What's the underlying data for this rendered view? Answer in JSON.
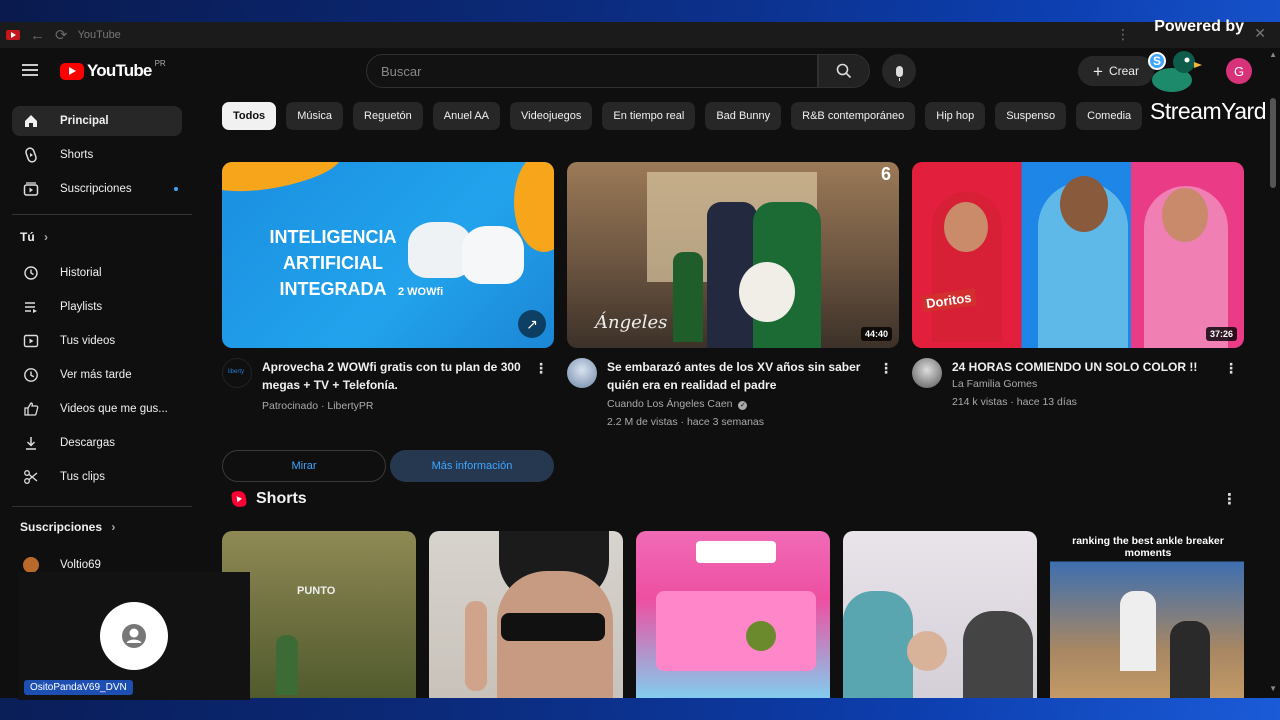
{
  "window": {
    "title": "YouTube"
  },
  "header": {
    "logo_text": "YouTube",
    "region": "PR",
    "search_placeholder": "Buscar",
    "create_label": "Crear",
    "avatar_letter": "G",
    "overlay_avatar_letter": "S"
  },
  "streamyard": {
    "powered_by": "Powered by",
    "name": "StreamYard"
  },
  "sidebar": {
    "top": [
      {
        "label": "Principal",
        "icon": "home-icon"
      },
      {
        "label": "Shorts",
        "icon": "shorts-icon"
      },
      {
        "label": "Suscripciones",
        "icon": "subscriptions-icon"
      }
    ],
    "you_title": "Tú",
    "you_items": [
      {
        "label": "Historial",
        "icon": "history-icon"
      },
      {
        "label": "Playlists",
        "icon": "playlists-icon"
      },
      {
        "label": "Tus videos",
        "icon": "your-videos-icon"
      },
      {
        "label": "Ver más tarde",
        "icon": "watch-later-icon"
      },
      {
        "label": "Videos que me gus...",
        "icon": "liked-icon"
      },
      {
        "label": "Descargas",
        "icon": "download-icon"
      },
      {
        "label": "Tus clips",
        "icon": "clips-icon"
      }
    ],
    "subs_title": "Suscripciones",
    "subs_first": "Voltio69"
  },
  "chips": [
    "Todos",
    "Música",
    "Reguetón",
    "Anuel AA",
    "Videojuegos",
    "En tiempo real",
    "Bad Bunny",
    "R&B contemporáneo",
    "Hip hop",
    "Suspenso",
    "Comedia"
  ],
  "videos": [
    {
      "title": "Aprovecha 2 WOWfi gratis con tu plan de 300 megas + TV + Telefonía.",
      "line1": "Patrocinado · LibertyPR",
      "line2": "",
      "duration": "",
      "thumb_text": "INTELIGENCIA ARTIFICIAL INTEGRADA",
      "thumb_sub": "2 WOWfi",
      "channel_avatar": "liberty",
      "btn_watch": "Mirar",
      "btn_more": "Más información"
    },
    {
      "title": "Se embarazó antes de los XV años sin saber quién era en realidad el padre",
      "line1": "Cuando Los Ángeles Caen",
      "line2": "2.2 M de vistas · hace 3 semanas",
      "duration": "44:40",
      "thumb_text": "Ángeles",
      "badge": "6"
    },
    {
      "title": "24 HORAS COMIENDO UN SOLO COLOR !!",
      "line1": "La Familia Gomes",
      "line2": "214 k vistas · hace 13 días",
      "duration": "37:26",
      "thumb_text": "Doritos"
    }
  ],
  "shorts": {
    "title": "Shorts",
    "items": [
      {
        "caption": "PUNTO"
      },
      {
        "caption": ""
      },
      {
        "caption": ""
      },
      {
        "caption": ""
      },
      {
        "caption": "ranking the best ankle breaker moments"
      }
    ]
  },
  "webcam": {
    "name": "OsitoPandaV69_DVN"
  }
}
